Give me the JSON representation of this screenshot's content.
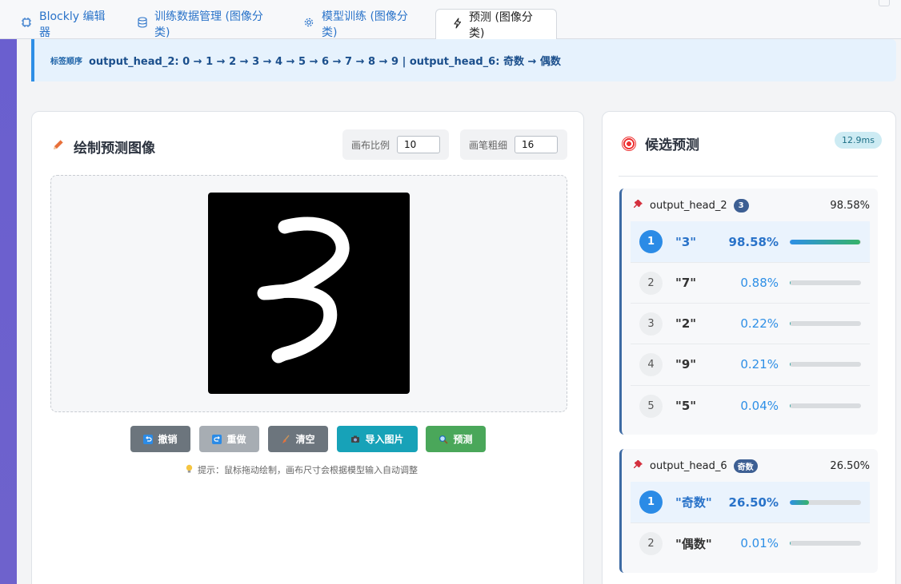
{
  "tabs": [
    {
      "label": "Blockly 编辑器",
      "icon": "cpu-icon",
      "active": false
    },
    {
      "label": "训练数据管理 (图像分类)",
      "icon": "database-icon",
      "active": false
    },
    {
      "label": "模型训练 (图像分类)",
      "icon": "gear-icon",
      "active": false
    },
    {
      "label": "预测 (图像分类)",
      "icon": "lightning-icon",
      "active": true
    }
  ],
  "banner": {
    "label": "标签顺序",
    "text": "output_head_2: 0 → 1 → 2 → 3 → 4 → 5 → 6 → 7 → 8 → 9 | output_head_6: 奇数 → 偶数"
  },
  "draw_panel": {
    "title": "绘制预测图像",
    "scale_label": "画布比例",
    "scale_value": "10",
    "brush_label": "画笔粗细",
    "brush_value": "16",
    "buttons": {
      "undo": "撤销",
      "redo": "重做",
      "clear": "清空",
      "import": "导入图片",
      "predict": "预测"
    },
    "hint": "提示：鼠标拖动绘制，画布尺寸会根据模型输入自动调整"
  },
  "predictions": {
    "title": "候选预测",
    "timing": "12.9ms",
    "heads": [
      {
        "name": "output_head_2",
        "badge": "3",
        "top_pct": "98.58%",
        "items": [
          {
            "rank": "1",
            "label": "\"3\"",
            "pct": "98.58%",
            "value": 0.9858
          },
          {
            "rank": "2",
            "label": "\"7\"",
            "pct": "0.88%",
            "value": 0.0088
          },
          {
            "rank": "3",
            "label": "\"2\"",
            "pct": "0.22%",
            "value": 0.0022
          },
          {
            "rank": "4",
            "label": "\"9\"",
            "pct": "0.21%",
            "value": 0.0021
          },
          {
            "rank": "5",
            "label": "\"5\"",
            "pct": "0.04%",
            "value": 0.0004
          }
        ]
      },
      {
        "name": "output_head_6",
        "badge": "奇数",
        "top_pct": "26.50%",
        "items": [
          {
            "rank": "1",
            "label": "\"奇数\"",
            "pct": "26.50%",
            "value": 0.265
          },
          {
            "rank": "2",
            "label": "\"偶数\"",
            "pct": "0.01%",
            "value": 0.0001
          }
        ]
      }
    ]
  },
  "colors": {
    "accent": "#2e8fe6",
    "primary_rank": "#2b8be6",
    "badge": "#3d5f93"
  }
}
